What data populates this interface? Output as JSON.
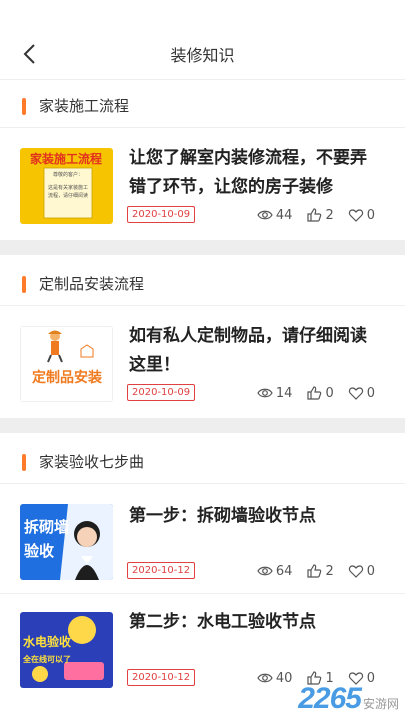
{
  "header": {
    "title": "装修知识"
  },
  "sections": [
    {
      "label": "家装施工流程",
      "items": [
        {
          "title": "让您了解室内装修流程，不要弄错了环节，让您的房子装修",
          "date": "2020-10-09",
          "views": "44",
          "likes": "2",
          "favorites": "0",
          "thumb": {
            "caption": "家装施工流程",
            "line1": "尊敬的客户：",
            "line2": "这是有关家装施工",
            "line3": "流程，请仔细阅读"
          }
        }
      ]
    },
    {
      "label": "定制品安装流程",
      "items": [
        {
          "title": "如有私人定制物品，请仔细阅读这里！",
          "date": "2020-10-09",
          "views": "14",
          "likes": "0",
          "favorites": "0",
          "thumb": {
            "caption": "定制品安装"
          }
        }
      ]
    },
    {
      "label": "家装验收七步曲",
      "items": [
        {
          "title": "第一步：拆砌墙验收节点",
          "date": "2020-10-12",
          "views": "64",
          "likes": "2",
          "favorites": "0",
          "thumb": {
            "line1": "拆砌墙",
            "line2": "验收"
          }
        },
        {
          "title": "第二步：水电工验收节点",
          "date": "2020-10-12",
          "views": "40",
          "likes": "1",
          "favorites": "0",
          "thumb": {
            "line1": "水电验收",
            "line2": "全在线可以了"
          }
        }
      ]
    }
  ],
  "watermark": {
    "number": "2265",
    "text": "安游网"
  },
  "colors": {
    "accent": "#ff7a2a",
    "date": "#e04040",
    "watermark": "#2a8be0"
  }
}
